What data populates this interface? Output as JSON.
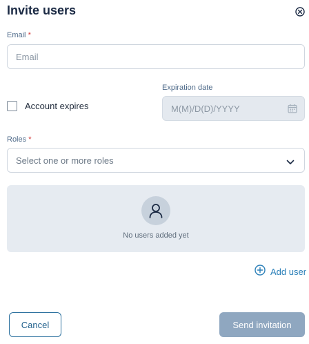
{
  "dialog": {
    "title": "Invite users",
    "close_icon": "close-circle-icon"
  },
  "email": {
    "label": "Email",
    "required_mark": "*",
    "placeholder": "Email",
    "value": ""
  },
  "account_expires": {
    "label": "Account expires",
    "checked": false
  },
  "expiration_date": {
    "label": "Expiration date",
    "placeholder": "M(M)/D(D)/YYYY",
    "disabled": true,
    "icon": "calendar-icon"
  },
  "roles": {
    "label": "Roles",
    "required_mark": "*",
    "placeholder": "Select one or more roles",
    "icon": "chevron-down-icon"
  },
  "users_panel": {
    "empty_text": "No users added yet",
    "icon": "user-icon"
  },
  "add_user": {
    "label": "Add user",
    "icon": "plus-circle-icon"
  },
  "footer": {
    "cancel_label": "Cancel",
    "send_label": "Send invitation",
    "send_disabled": true
  },
  "colors": {
    "accent": "#2a7fb8",
    "required": "#d33a3a",
    "disabled_button": "#8fa7c0",
    "panel_background": "#e6ebf1"
  }
}
